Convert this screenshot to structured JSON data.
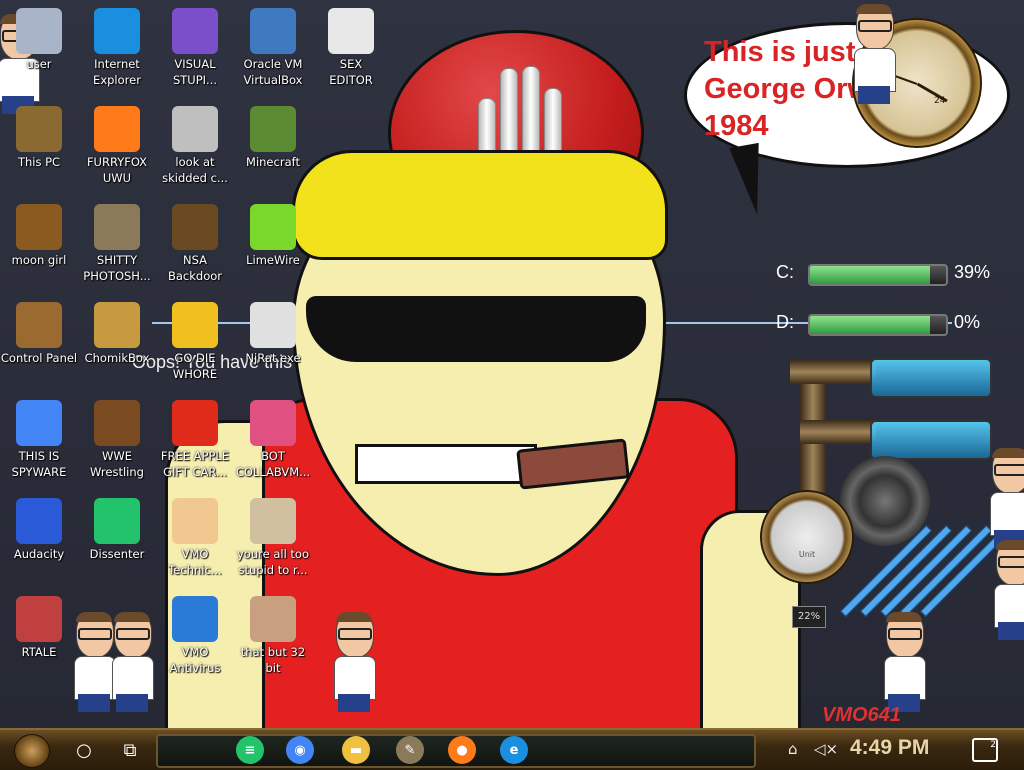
{
  "desktop": {
    "icons": [
      {
        "label": "user",
        "icon": "user-folder-icon",
        "color": "#a8b4c8"
      },
      {
        "label": "Internet\nExplorer",
        "icon": "edge-icon",
        "color": "#1a8fe0"
      },
      {
        "label": "VISUAL\nSTUPI...",
        "icon": "visual-studio-icon",
        "color": "#7a4fc9"
      },
      {
        "label": "Oracle VM\nVirtualBox",
        "icon": "virtualbox-icon",
        "color": "#3f7ac0"
      },
      {
        "label": "SEX\nEDITOR",
        "icon": "hxd-icon",
        "color": "#e8e8e8"
      },
      {
        "label": "This PC",
        "icon": "computer-icon",
        "color": "#8a6a30"
      },
      {
        "label": "FURRYFOX\nUWU",
        "icon": "firefox-icon",
        "color": "#ff7a18"
      },
      {
        "label": "look at\nskidded c...",
        "icon": "copy-icon",
        "color": "#bfbfbf"
      },
      {
        "label": "Minecraft",
        "icon": "minecraft-icon",
        "color": "#5a8a32"
      },
      {
        "label": "moon girl",
        "icon": "moon-girl-icon",
        "color": "#8a5a20"
      },
      {
        "label": "SHITTY\nPHOTOSH...",
        "icon": "gimp-icon",
        "color": "#8a7a5a"
      },
      {
        "label": "NSA\nBackdoor",
        "icon": "nsa-backdoor-icon",
        "color": "#6a4a20"
      },
      {
        "label": "LimeWire",
        "icon": "limewire-icon",
        "color": "#7ad82a"
      },
      {
        "label": "Control Panel",
        "icon": "control-panel-icon",
        "color": "#9a6a30"
      },
      {
        "label": "ChomikBox",
        "icon": "chomikbox-icon",
        "color": "#c89a40"
      },
      {
        "label": "GO DIE\nWHORE",
        "icon": "die-icon",
        "color": "#f0c020"
      },
      {
        "label": "NjRat.exe",
        "icon": "skull-icon",
        "color": "#e0e0e0"
      },
      {
        "label": "THIS IS\nSPYWARE",
        "icon": "chrome-icon",
        "color": "#4285f4"
      },
      {
        "label": "WWE\nWrestling",
        "icon": "wrestling-icon",
        "color": "#7a4a20"
      },
      {
        "label": "FREE APPLE\nGIFT CAR...",
        "icon": "apple-icon",
        "color": "#e02a1a"
      },
      {
        "label": "BOT\nCOLLABVM...",
        "icon": "bot-collabvm-icon",
        "color": "#e05080"
      },
      {
        "label": "Audacity",
        "icon": "audacity-icon",
        "color": "#2a5ad8"
      },
      {
        "label": "Dissenter",
        "icon": "dissenter-icon",
        "color": "#22c36a"
      },
      {
        "label": "VMO\nTechnic...",
        "icon": "technician-icon",
        "color": "#f0c890"
      },
      {
        "label": "youre all too\nstupid to r...",
        "icon": "portrait-icon",
        "color": "#d0c0a0"
      },
      {
        "label": "RTALE",
        "icon": "rtale-icon",
        "color": "#c04040"
      },
      {
        "label": "VMO\nAntivirus",
        "icon": "shield-icon",
        "color": "#2a7ad8"
      },
      {
        "label": "that but 32\nbit",
        "icon": "portrait-icon",
        "color": "#c8a080"
      }
    ],
    "speech_bubble": "This is just like\nGeorge Orwell's\n1984",
    "overlay_text": "Oops! You have   this website has been deemed inappropriate",
    "watermark": "VMO641",
    "clock_sub": "24",
    "drives": [
      {
        "letter": "C:",
        "percent": "39%",
        "fill": 0.39
      },
      {
        "letter": "D:",
        "percent": "0%",
        "fill": 0.0
      }
    ],
    "gauge_label": "Unit",
    "gauge_counter": "22%"
  },
  "taskbar": {
    "search_glyph": "○",
    "taskview_glyph": "⧉",
    "apps": [
      {
        "icon": "dissenter-icon",
        "glyph": "≡",
        "color": "#22c36a"
      },
      {
        "icon": "chrome-icon",
        "glyph": "◉",
        "color": "#4285f4"
      },
      {
        "icon": "file-explorer-icon",
        "glyph": "▬",
        "color": "#f0c040"
      },
      {
        "icon": "gimp-icon",
        "glyph": "✎",
        "color": "#8a7a5a"
      },
      {
        "icon": "firefox-icon",
        "glyph": "●",
        "color": "#ff7a18"
      },
      {
        "icon": "edge-icon",
        "glyph": "e",
        "color": "#1a8fe0"
      }
    ],
    "time": "4:49 PM",
    "notifications": "2"
  }
}
